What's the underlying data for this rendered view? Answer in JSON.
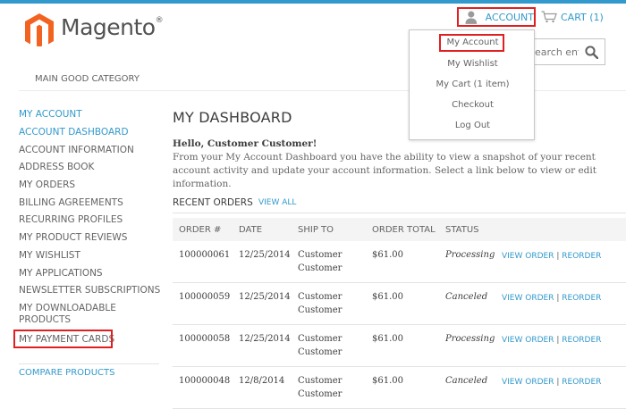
{
  "header": {
    "logo_text": "Magento",
    "logo_mark": "®",
    "account_label": "ACCOUNT",
    "cart_label": "CART (1)",
    "search_placeholder": "Search entire store here..."
  },
  "nav": {
    "items": [
      "MAIN GOOD CATEGORY"
    ]
  },
  "dropdown": {
    "items": [
      "My Account",
      "My Wishlist",
      "My Cart (1 item)",
      "Checkout",
      "Log Out"
    ]
  },
  "sidebar": {
    "title": "MY ACCOUNT",
    "items": [
      "ACCOUNT DASHBOARD",
      "ACCOUNT INFORMATION",
      "ADDRESS BOOK",
      "MY ORDERS",
      "BILLING AGREEMENTS",
      "RECURRING PROFILES",
      "MY PRODUCT REVIEWS",
      "MY WISHLIST",
      "MY APPLICATIONS",
      "NEWSLETTER SUBSCRIPTIONS",
      "MY DOWNLOADABLE PRODUCTS",
      "MY PAYMENT CARDS"
    ],
    "next_section": "COMPARE PRODUCTS"
  },
  "main": {
    "title": "MY DASHBOARD",
    "hello": "Hello, Customer Customer!",
    "intro": "From your My Account Dashboard you have the ability to view a snapshot of your recent account activity and update your account information. Select a link below to view or edit information.",
    "recent_title": "RECENT ORDERS",
    "view_all": "VIEW ALL"
  },
  "orders": {
    "columns": [
      "ORDER #",
      "DATE",
      "SHIP TO",
      "ORDER TOTAL",
      "STATUS"
    ],
    "view_label": "VIEW ORDER",
    "separator": "|",
    "reorder_label": "REORDER",
    "rows": [
      {
        "order": "100000061",
        "date": "12/25/2014",
        "ship1": "Customer",
        "ship2": "Customer",
        "total": "$61.00",
        "status": "Processing"
      },
      {
        "order": "100000059",
        "date": "12/25/2014",
        "ship1": "Customer",
        "ship2": "Customer",
        "total": "$61.00",
        "status": "Canceled"
      },
      {
        "order": "100000058",
        "date": "12/25/2014",
        "ship1": "Customer",
        "ship2": "Customer",
        "total": "$61.00",
        "status": "Processing"
      },
      {
        "order": "100000048",
        "date": "12/8/2014",
        "ship1": "Customer",
        "ship2": "Customer",
        "total": "$61.00",
        "status": "Canceled"
      }
    ]
  },
  "colors": {
    "accent": "#3399cc",
    "highlight": "#e02020",
    "logo_orange": "#f26322"
  },
  "icons": {
    "logo": "magento-logo-icon",
    "account": "user-icon",
    "cart": "cart-icon",
    "search": "search-icon"
  }
}
